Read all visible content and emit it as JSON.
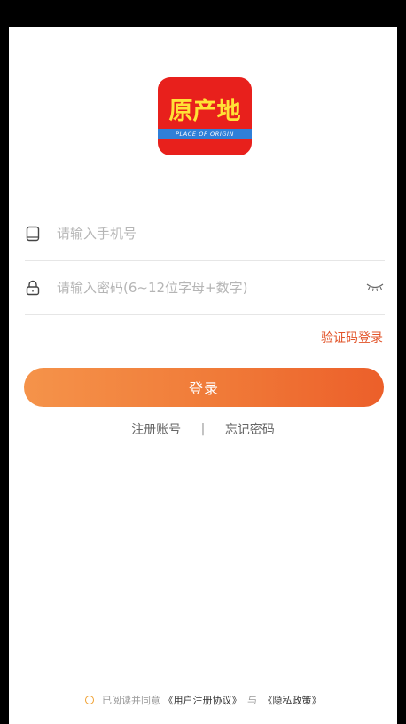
{
  "logo": {
    "name_cn": "原产地",
    "band_text": "PLACE OF ORIGIN"
  },
  "form": {
    "phone_placeholder": "请输入手机号",
    "password_placeholder": "请输入密码(6~12位字母+数字)",
    "sms_login_label": "验证码登录",
    "login_button_label": "登录"
  },
  "links": {
    "register_label": "注册账号",
    "separator": "|",
    "forgot_label": "忘记密码"
  },
  "agreement": {
    "prefix": "已阅读并同意",
    "user_agreement": "《用户注册协议》",
    "conjunction": "与",
    "privacy_policy": "《隐私政策》"
  },
  "colors": {
    "accent": "#f07a38",
    "link": "#e2542a",
    "logo_red": "#e8201c",
    "logo_yellow": "#ffe236",
    "logo_blue": "#2f7fd8"
  },
  "icons": {
    "phone": "phone-icon",
    "lock": "lock-icon",
    "eye": "eye-closed-icon"
  }
}
